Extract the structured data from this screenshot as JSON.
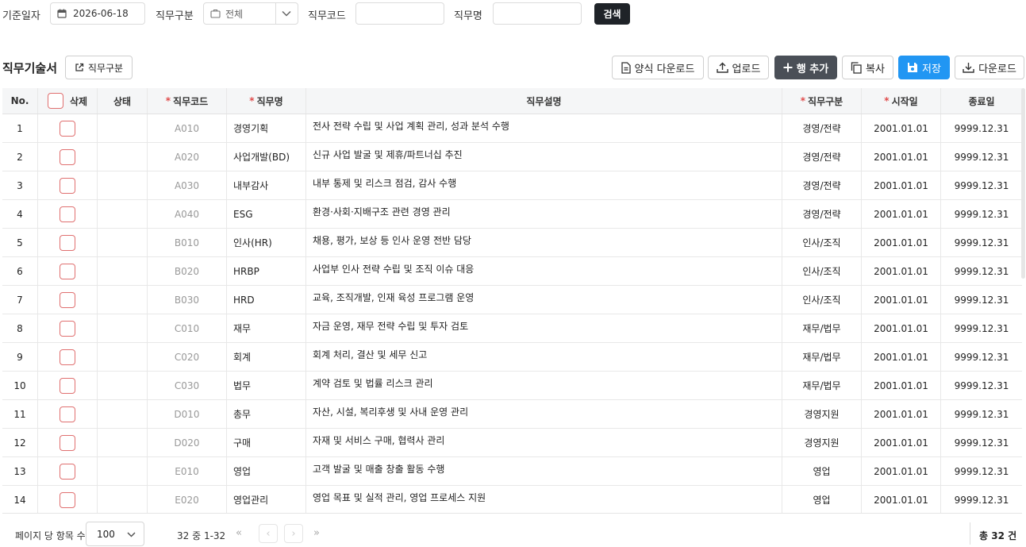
{
  "search": {
    "date_label": "기준일자",
    "date_value": "2026-06-18",
    "type_label": "직무구분",
    "type_value": "전체",
    "code_label": "직무코드",
    "name_label": "직무명",
    "search_button": "검색"
  },
  "section": {
    "title": "직무기술서",
    "type_button": "직무구분"
  },
  "toolbar": {
    "template_download": "양식 다운로드",
    "upload": "업로드",
    "add_row": "행 추가",
    "copy": "복사",
    "save": "저장",
    "download": "다운로드"
  },
  "table": {
    "headers": {
      "no": "No.",
      "delete": "삭제",
      "status": "상태",
      "code": "직무코드",
      "name": "직무명",
      "desc": "직무설명",
      "type": "직무구분",
      "start": "시작일",
      "end": "종료일"
    },
    "rows": [
      {
        "no": "1",
        "code": "A010",
        "name": "경영기획",
        "desc": "전사 전략 수립 및 사업 계획 관리, 성과 분석 수행",
        "type": "경영/전략",
        "start": "2001.01.01",
        "end": "9999.12.31"
      },
      {
        "no": "2",
        "code": "A020",
        "name": "사업개발(BD)",
        "desc": "신규 사업 발굴 및 제휴/파트너십 추진",
        "type": "경영/전략",
        "start": "2001.01.01",
        "end": "9999.12.31"
      },
      {
        "no": "3",
        "code": "A030",
        "name": "내부감사",
        "desc": "내부 통제 및 리스크 점검, 감사 수행",
        "type": "경영/전략",
        "start": "2001.01.01",
        "end": "9999.12.31"
      },
      {
        "no": "4",
        "code": "A040",
        "name": "ESG",
        "desc": "환경·사회·지배구조 관련 경영 관리",
        "type": "경영/전략",
        "start": "2001.01.01",
        "end": "9999.12.31"
      },
      {
        "no": "5",
        "code": "B010",
        "name": "인사(HR)",
        "desc": "채용, 평가, 보상 등 인사 운영 전반 담당",
        "type": "인사/조직",
        "start": "2001.01.01",
        "end": "9999.12.31"
      },
      {
        "no": "6",
        "code": "B020",
        "name": "HRBP",
        "desc": "사업부 인사 전략 수립 및 조직 이슈 대응",
        "type": "인사/조직",
        "start": "2001.01.01",
        "end": "9999.12.31"
      },
      {
        "no": "7",
        "code": "B030",
        "name": "HRD",
        "desc": "교육, 조직개발, 인재 육성 프로그램 운영",
        "type": "인사/조직",
        "start": "2001.01.01",
        "end": "9999.12.31"
      },
      {
        "no": "8",
        "code": "C010",
        "name": "재무",
        "desc": "자금 운영, 재무 전략 수립 및 투자 검토",
        "type": "재무/법무",
        "start": "2001.01.01",
        "end": "9999.12.31"
      },
      {
        "no": "9",
        "code": "C020",
        "name": "회계",
        "desc": "회계 처리, 결산 및 세무 신고",
        "type": "재무/법무",
        "start": "2001.01.01",
        "end": "9999.12.31"
      },
      {
        "no": "10",
        "code": "C030",
        "name": "법무",
        "desc": "계약 검토 및 법률 리스크 관리",
        "type": "재무/법무",
        "start": "2001.01.01",
        "end": "9999.12.31"
      },
      {
        "no": "11",
        "code": "D010",
        "name": "총무",
        "desc": "자산, 시설, 복리후생 및 사내 운영 관리",
        "type": "경영지원",
        "start": "2001.01.01",
        "end": "9999.12.31"
      },
      {
        "no": "12",
        "code": "D020",
        "name": "구매",
        "desc": "자재 및 서비스 구매, 협력사 관리",
        "type": "경영지원",
        "start": "2001.01.01",
        "end": "9999.12.31"
      },
      {
        "no": "13",
        "code": "E010",
        "name": "영업",
        "desc": "고객 발굴 및 매출 창출 활동 수행",
        "type": "영업",
        "start": "2001.01.01",
        "end": "9999.12.31"
      },
      {
        "no": "14",
        "code": "E020",
        "name": "영업관리",
        "desc": "영업 목표 및 실적 관리, 영업 프로세스 지원",
        "type": "영업",
        "start": "2001.01.01",
        "end": "9999.12.31"
      }
    ]
  },
  "pagination": {
    "per_page_label": "페이지 당 항목 수",
    "per_page_value": "100",
    "range_text": "32 중 1-32",
    "total_prefix": "총 ",
    "total_count": "32",
    "total_suffix": " 건"
  },
  "colors": {
    "primary": "#2196f3",
    "dark": "#4a4f57",
    "search": "#1f2328",
    "required": "#e04b4b"
  }
}
